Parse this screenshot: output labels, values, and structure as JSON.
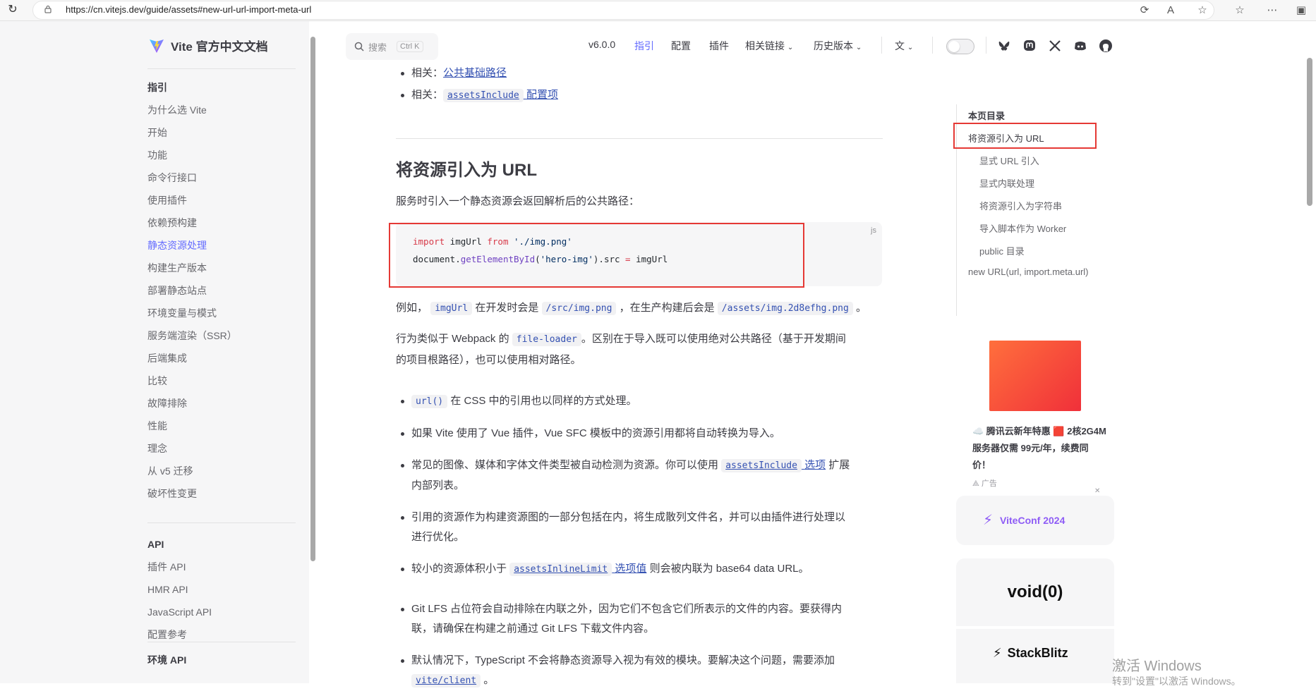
{
  "browser": {
    "url": "https://cn.vitejs.dev/guide/assets#new-url-url-import-meta-url"
  },
  "site": {
    "title": "Vite 官方中文文档"
  },
  "search": {
    "label": "搜索",
    "shortcut": "Ctrl K"
  },
  "nav": {
    "version": "v6.0.0",
    "guide": "指引",
    "config": "配置",
    "plugins": "插件",
    "links": "相关链接",
    "history": "历史版本"
  },
  "sidebar": {
    "guide_title": "指引",
    "guide_items": [
      "为什么选 Vite",
      "开始",
      "功能",
      "命令行接口",
      "使用插件",
      "依赖预构建",
      "静态资源处理",
      "构建生产版本",
      "部署静态站点",
      "环境变量与模式",
      "服务端渲染（SSR）",
      "后端集成",
      "比较",
      "故障排除",
      "性能",
      "理念",
      "从 v5 迁移",
      "破坏性变更"
    ],
    "active": "静态资源处理",
    "api_title": "API",
    "api_items": [
      "插件 API",
      "HMR API",
      "JavaScript API",
      "配置参考"
    ],
    "env_title": "环境 API"
  },
  "content": {
    "related1_prefix": "相关：",
    "related1_link": "公共基础路径",
    "related2_prefix": "相关：",
    "related2_code": "assetsInclude",
    "related2_link": "配置项",
    "heading": "将资源引入为 URL",
    "intro": "服务时引入一个静态资源会返回解析后的公共路径：",
    "code_lang": "js",
    "example": {
      "p1": "例如，",
      "c1": "imgUrl",
      "p2": "在开发时会是",
      "c2": "/src/img.png",
      "p3": "，在生产构建后会是",
      "c3": "/assets/img.2d8efhg.png",
      "p4": "。"
    },
    "webpack": {
      "p1": "行为类似于 Webpack 的",
      "c1": "file-loader",
      "p2": "。区别在于导入既可以使用绝对公共路径（基于开发期间",
      "p3": "的项目根路径），也可以使用相对路径。"
    },
    "b1_code": "url()",
    "b1_text": "在 CSS 中的引用也以同样的方式处理。",
    "b2": "如果 Vite 使用了 Vue 插件，Vue SFC 模板中的资源引用都将自动转换为导入。",
    "b3_text": "常见的图像、媒体和字体文件类型被自动检测为资源。你可以使用",
    "b3_code": "assetsInclude",
    "b3_link": "选项",
    "b3_text2": "扩展",
    "b3_text3": "内部列表。",
    "b4_l1": "引用的资源作为构建资源图的一部分包括在内，将生成散列文件名，并可以由插件进行处理以",
    "b4_l2": "进行优化。",
    "b5_text": "较小的资源体积小于",
    "b5_code": "assetsInlineLimit",
    "b5_link": "选项值",
    "b5_text2": "则会被内联为 base64 data URL。",
    "b6_l1": "Git LFS 占位符会自动排除在内联之外，因为它们不包含它们所表示的文件的内容。要获得内",
    "b6_l2": "联，请确保在构建之前通过 Git LFS 下载文件内容。",
    "b7_l1": "默认情况下，TypeScript 不会将静态资源导入视为有效的模块。要解决这个问题，需要添加",
    "b7_code": "vite/client",
    "b7_end": "。"
  },
  "code": {
    "l1_kw": "import",
    "l1_id": " imgUrl ",
    "l1_from": "from",
    "l1_str": " './img.png'",
    "l2_a": "document.",
    "l2_fn": "getElementById",
    "l2_b": "(",
    "l2_str": "'hero-img'",
    "l2_c": ").src ",
    "l2_op": "=",
    "l2_d": " imgUrl"
  },
  "toc": {
    "title": "本页目录",
    "items": [
      "将资源引入为 URL",
      "显式 URL 引入",
      "显式内联处理",
      "将资源引入为字符串",
      "导入脚本作为 Worker",
      "public 目录",
      "new URL(url, import.meta.url)"
    ]
  },
  "ad": {
    "text": "☁️ 腾讯云新年特惠 🟥 2核2G4M服务器仅需 99元/年，续费同价！",
    "tag": "广告"
  },
  "sponsors": {
    "viteconf": "ViteConf 2024",
    "void": "void(0)",
    "stackblitz": "StackBlitz"
  },
  "watermark": {
    "l1": "激活 Windows",
    "l2": "转到\"设置\"以激活 Windows。"
  },
  "colors": {
    "accent": "#646cff",
    "link": "#3451b2",
    "highlight": "#e53935"
  }
}
